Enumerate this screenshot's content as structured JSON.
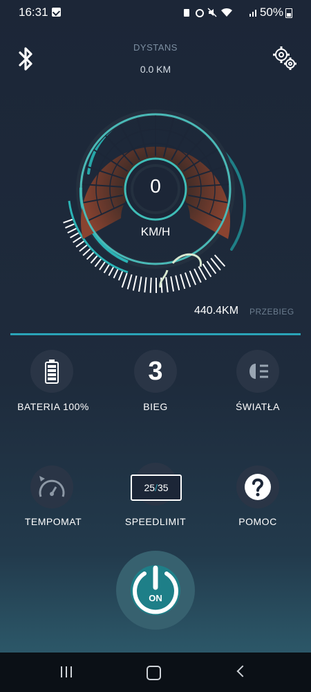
{
  "status_bar": {
    "time": "16:31",
    "battery": "50%"
  },
  "header": {
    "distance_label": "DYSTANS",
    "distance_value": "0.0 KM"
  },
  "gauge": {
    "speed": "0",
    "unit": "KM/H"
  },
  "odometer": {
    "value": "440.4KM",
    "label": "PRZEBIEG"
  },
  "tiles": {
    "battery": {
      "label": "BATERIA 100%",
      "icon": "battery-icon"
    },
    "gear": {
      "value": "3",
      "label": "BIEG"
    },
    "lights": {
      "label": "ŚWIATŁA",
      "icon": "headlight-icon"
    },
    "cruise": {
      "label": "TEMPOMAT",
      "icon": "speedometer-icon"
    },
    "speedlimit": {
      "current": "25",
      "separator": "/",
      "max": "35",
      "label": "SPEEDLIMIT"
    },
    "help": {
      "label": "POMOC",
      "icon": "question-icon"
    }
  },
  "power": {
    "label": "ON",
    "icon": "power-icon"
  },
  "colors": {
    "accent": "#2aa4b8",
    "background": "#1c2637",
    "gauge_fill": "#7a3a2c"
  }
}
